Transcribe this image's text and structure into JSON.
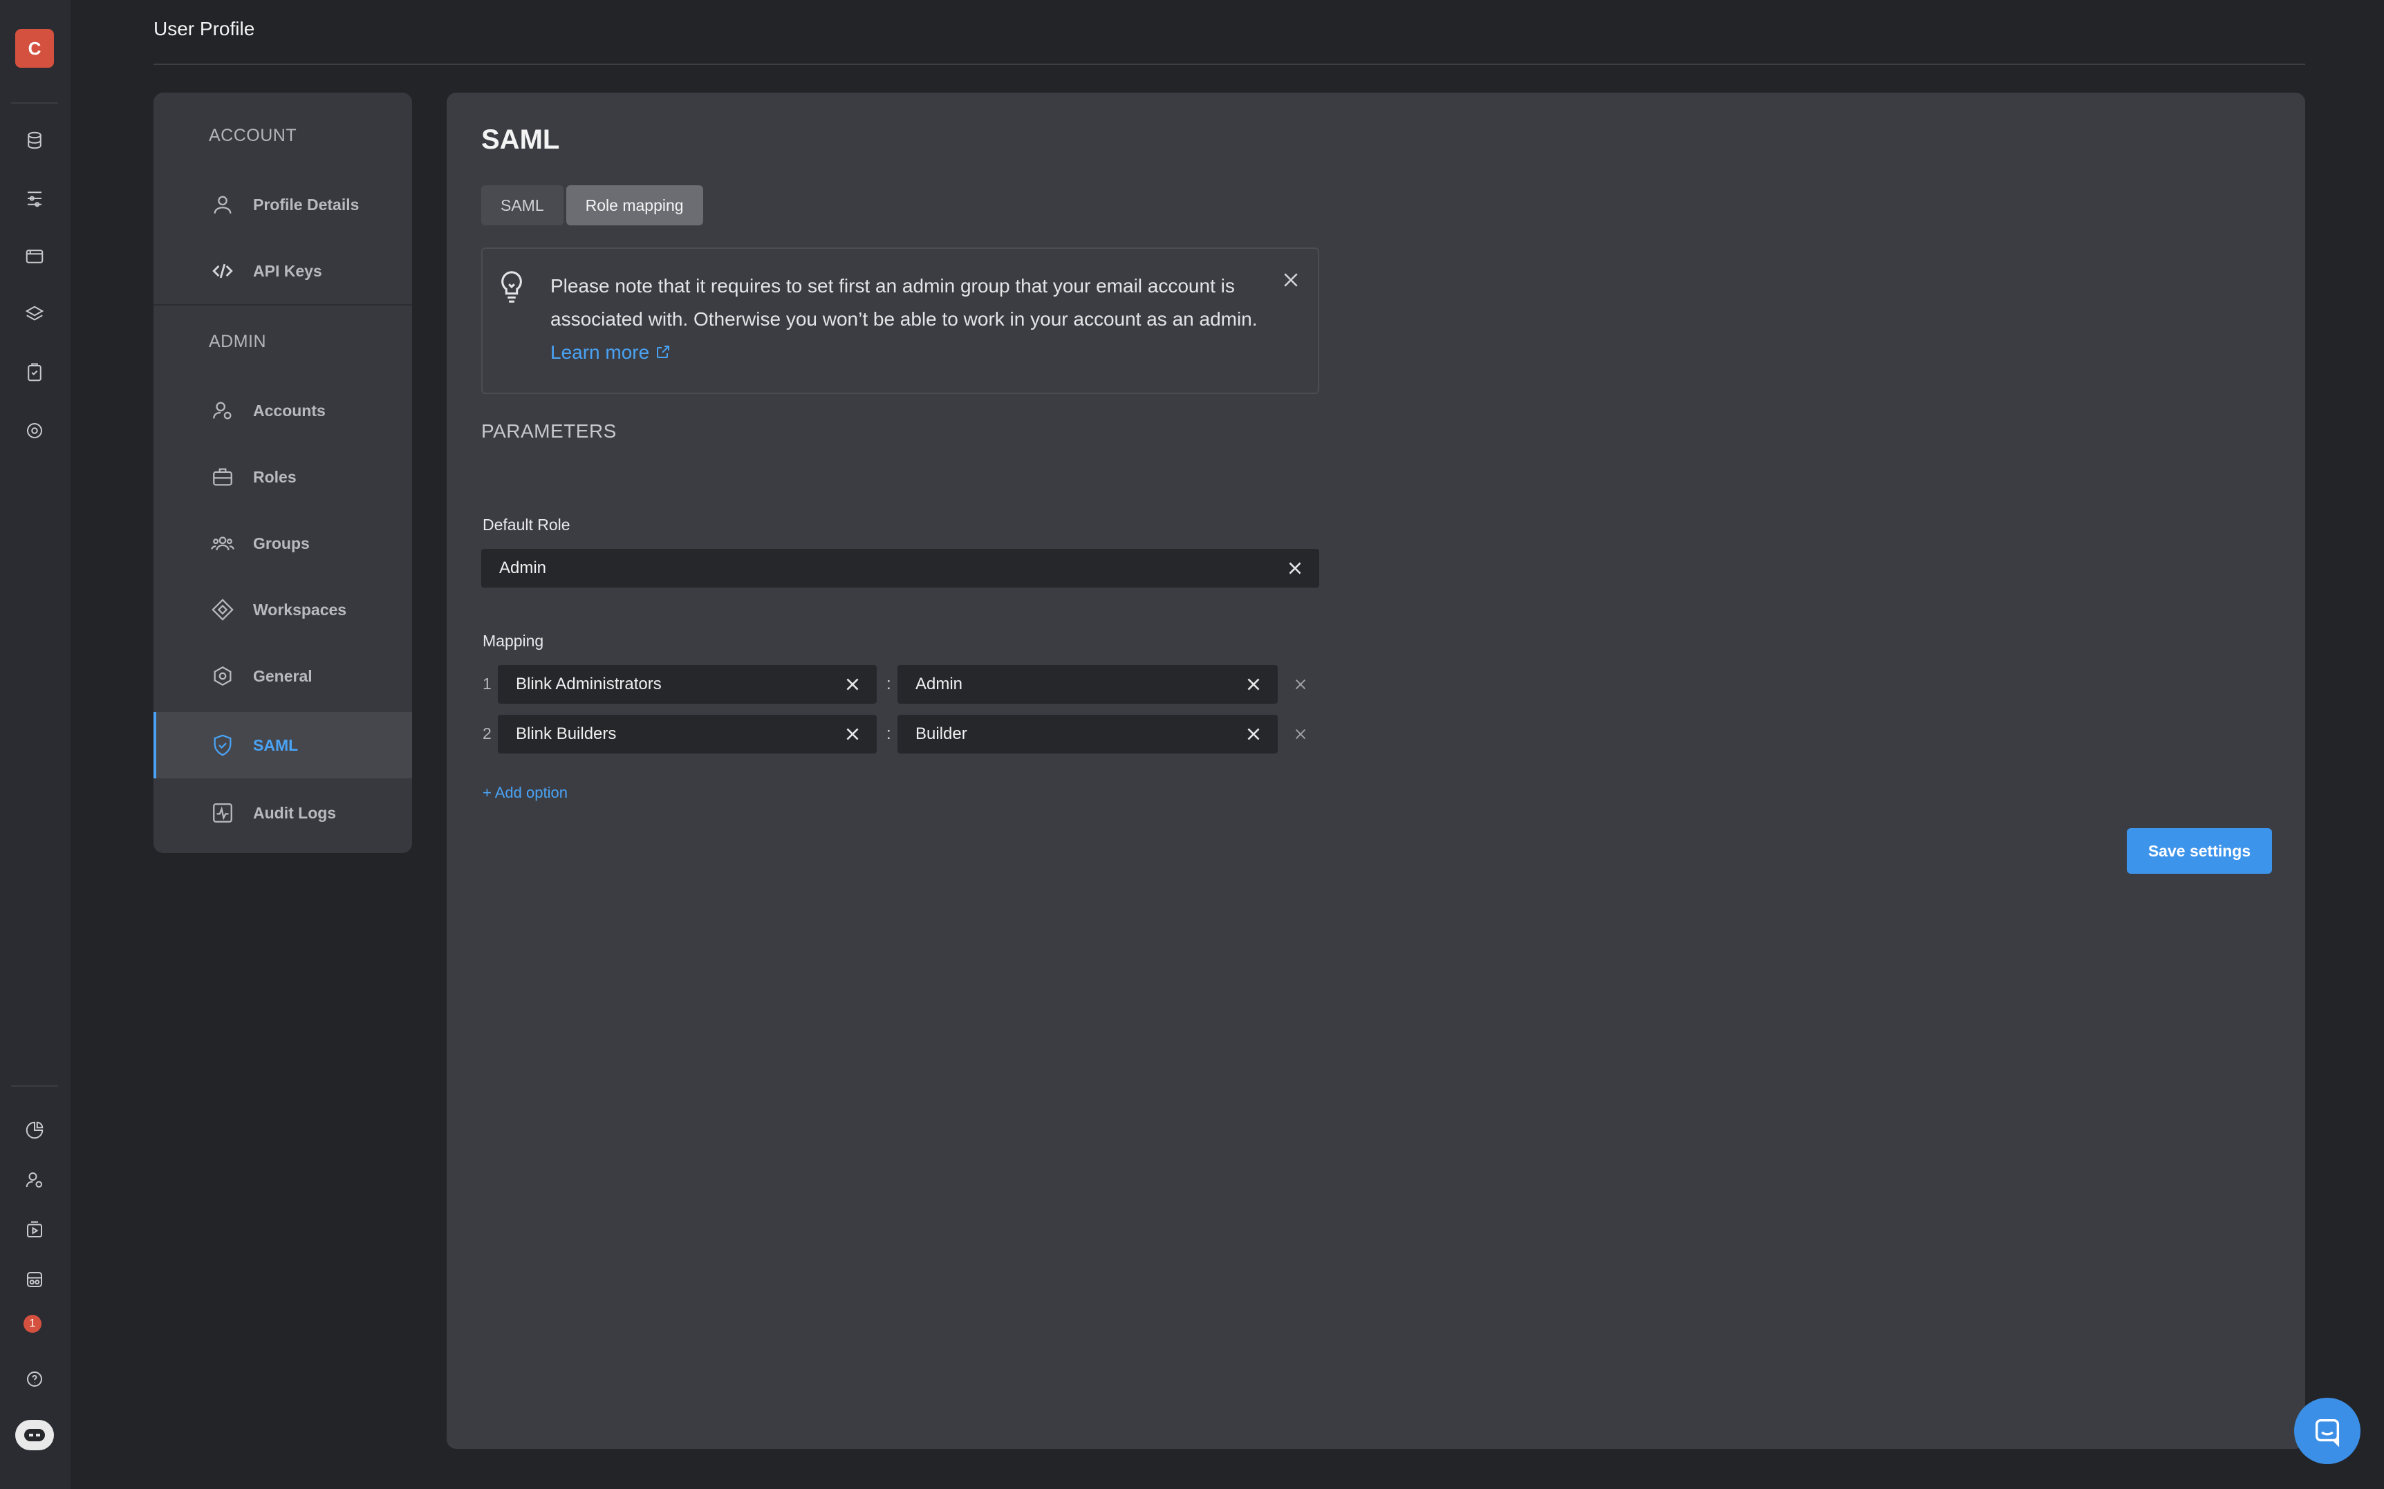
{
  "app": {
    "avatar_letter": "C",
    "notification_count": "1",
    "accent_color": "#4aa3f5",
    "brand_avatar_color": "#d4513f"
  },
  "header": {
    "title": "User Profile"
  },
  "settings_nav": {
    "account_section": "ACCOUNT",
    "admin_section": "ADMIN",
    "items": [
      {
        "label": "Profile Details",
        "icon": "user-icon"
      },
      {
        "label": "API Keys",
        "icon": "code-icon"
      },
      {
        "label": "Accounts",
        "icon": "user-gear-icon"
      },
      {
        "label": "Roles",
        "icon": "briefcase-icon"
      },
      {
        "label": "Groups",
        "icon": "group-icon"
      },
      {
        "label": "Workspaces",
        "icon": "workspace-icon"
      },
      {
        "label": "General",
        "icon": "hexagon-icon"
      },
      {
        "label": "SAML",
        "icon": "shield-icon",
        "active": true
      },
      {
        "label": "Audit Logs",
        "icon": "activity-icon"
      }
    ]
  },
  "main": {
    "title": "SAML",
    "tabs": [
      {
        "label": "SAML",
        "active": false
      },
      {
        "label": "Role mapping",
        "active": true
      }
    ],
    "notice": {
      "text": "Please note that it requires to set first an admin group that your email account is associated with. Otherwise you won’t be able to work in your account as an admin.",
      "link": "Learn more"
    },
    "parameters_heading": "PARAMETERS",
    "default_role": {
      "label": "Default Role",
      "value": "Admin"
    },
    "mapping": {
      "label": "Mapping",
      "rows": [
        {
          "index": "1",
          "group": "Blink Administrators",
          "role": "Admin"
        },
        {
          "index": "2",
          "group": "Blink Builders",
          "role": "Builder"
        }
      ],
      "separator": ":",
      "add_option": "+ Add option"
    },
    "save_button": "Save settings"
  }
}
